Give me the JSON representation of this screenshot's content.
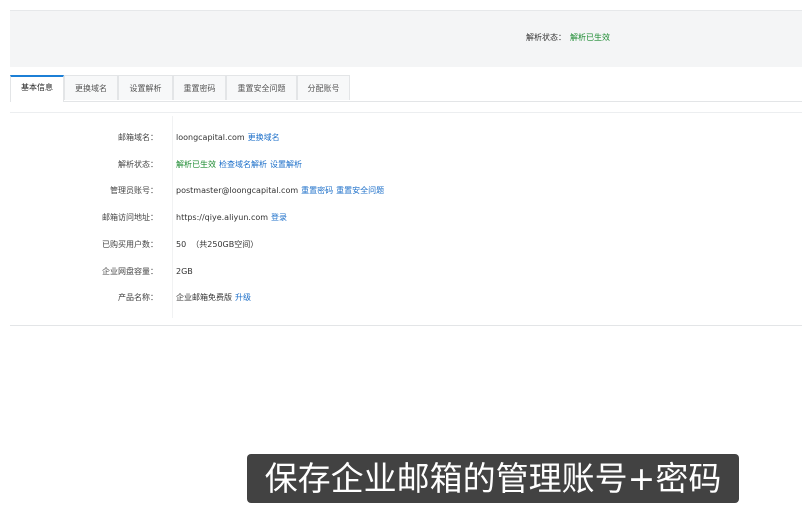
{
  "status": {
    "label": "解析状态：",
    "value": "解析已生效",
    "value_color": "#1d8b32"
  },
  "tabs": [
    {
      "label": "基本信息",
      "active": true
    },
    {
      "label": "更换域名",
      "active": false
    },
    {
      "label": "设置解析",
      "active": false
    },
    {
      "label": "重置密码",
      "active": false
    },
    {
      "label": "重置安全问题",
      "active": false
    },
    {
      "label": "分配账号",
      "active": false
    }
  ],
  "info": {
    "domain": {
      "label": "邮箱域名：",
      "value": "loongcapital.com",
      "link": "更换域名"
    },
    "dns": {
      "label": "解析状态：",
      "value": "解析已生效",
      "link1": "检查域名解析",
      "link2": "设置解析"
    },
    "admin": {
      "label": "管理员账号：",
      "value": "postmaster@loongcapital.com",
      "link1": "重置密码",
      "link2": "重置安全问题"
    },
    "url": {
      "label": "邮箱访问地址：",
      "value": "https://qiye.aliyun.com",
      "link": "登录"
    },
    "users": {
      "label": "已购买用户数：",
      "value": "50  （共250GB空间）"
    },
    "disk": {
      "label": "企业网盘容量：",
      "value": "2GB"
    },
    "product": {
      "label": "产品名称：",
      "value": "企业邮箱免费版",
      "link": "升级"
    }
  },
  "caption": "保存企业邮箱的管理账号+密码",
  "colors": {
    "accent": "#1c7fd6",
    "link": "#1c6fc9",
    "success": "#1d8b32"
  }
}
